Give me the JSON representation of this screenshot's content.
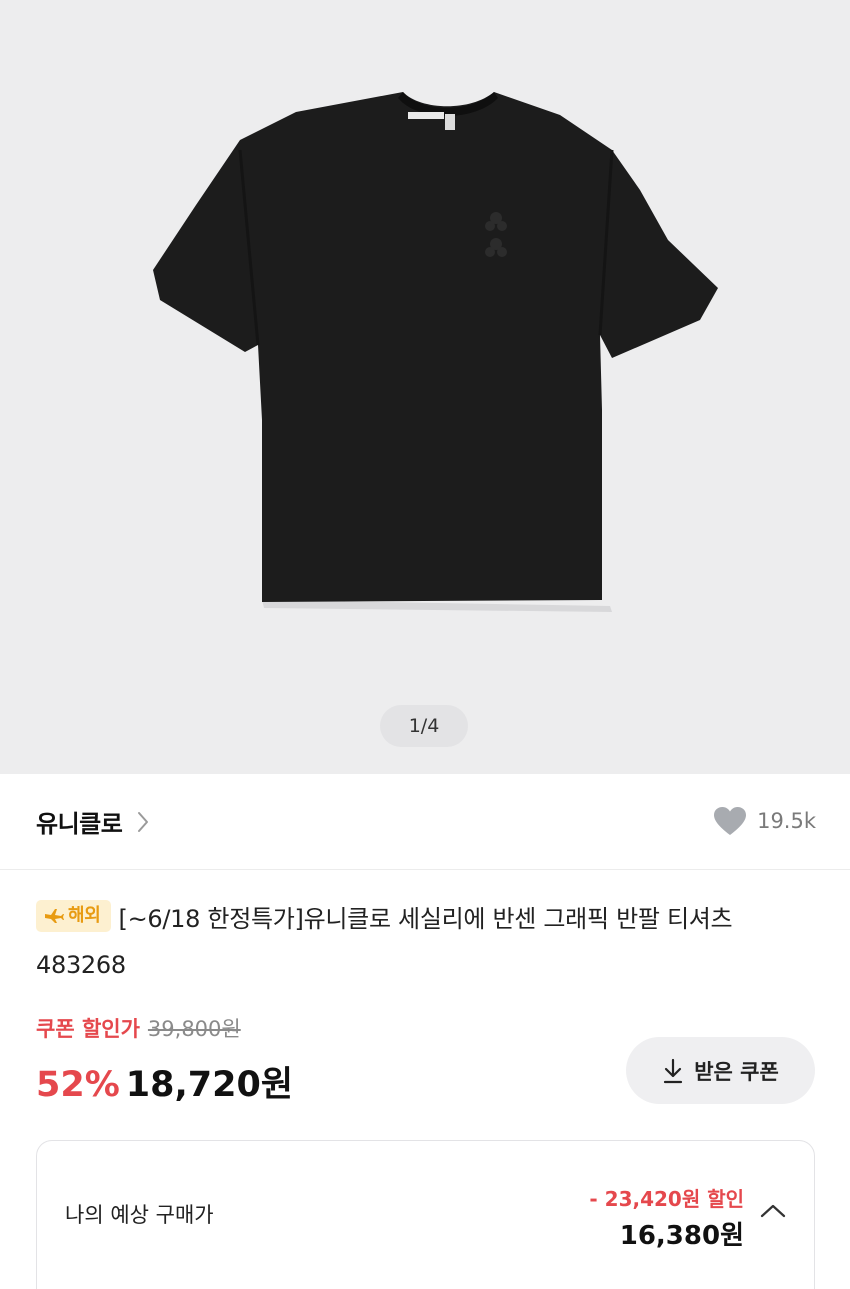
{
  "gallery": {
    "indicator": "1/4",
    "image_alt": "검은색 반팔 티셔츠"
  },
  "brand": {
    "name": "유니클로",
    "like_count": "19.5k"
  },
  "product": {
    "badge": "해외",
    "title": "[~6/18 한정특가]유니클로 세실리에 반센 그래픽 반팔 티셔츠 483268"
  },
  "price": {
    "coupon_label": "쿠폰 할인가",
    "original": "39,800원",
    "discount_rate": "52%",
    "final": "18,720원",
    "coupon_button": "받은 쿠폰"
  },
  "estimate": {
    "label": "나의 예상 구매가",
    "discount": "- 23,420원 할인",
    "price": "16,380원"
  },
  "colors": {
    "accent_red": "#e5484d",
    "badge_bg": "#fdf0d0",
    "badge_text": "#e89b12"
  }
}
